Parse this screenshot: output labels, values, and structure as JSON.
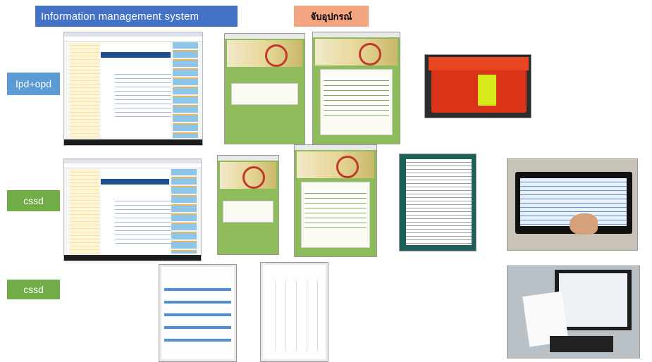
{
  "header": {
    "title": "Information management system",
    "orange_label": "จับอุปกรณ์"
  },
  "rows": {
    "row1_label": "Ipd+opd",
    "row2_label": "cssd",
    "row3_label": "cssd"
  },
  "colors": {
    "title_banner": "#4472c4",
    "orange_banner": "#f4a582",
    "blue_label": "#5b9bd5",
    "green_label": "#70ad47"
  }
}
